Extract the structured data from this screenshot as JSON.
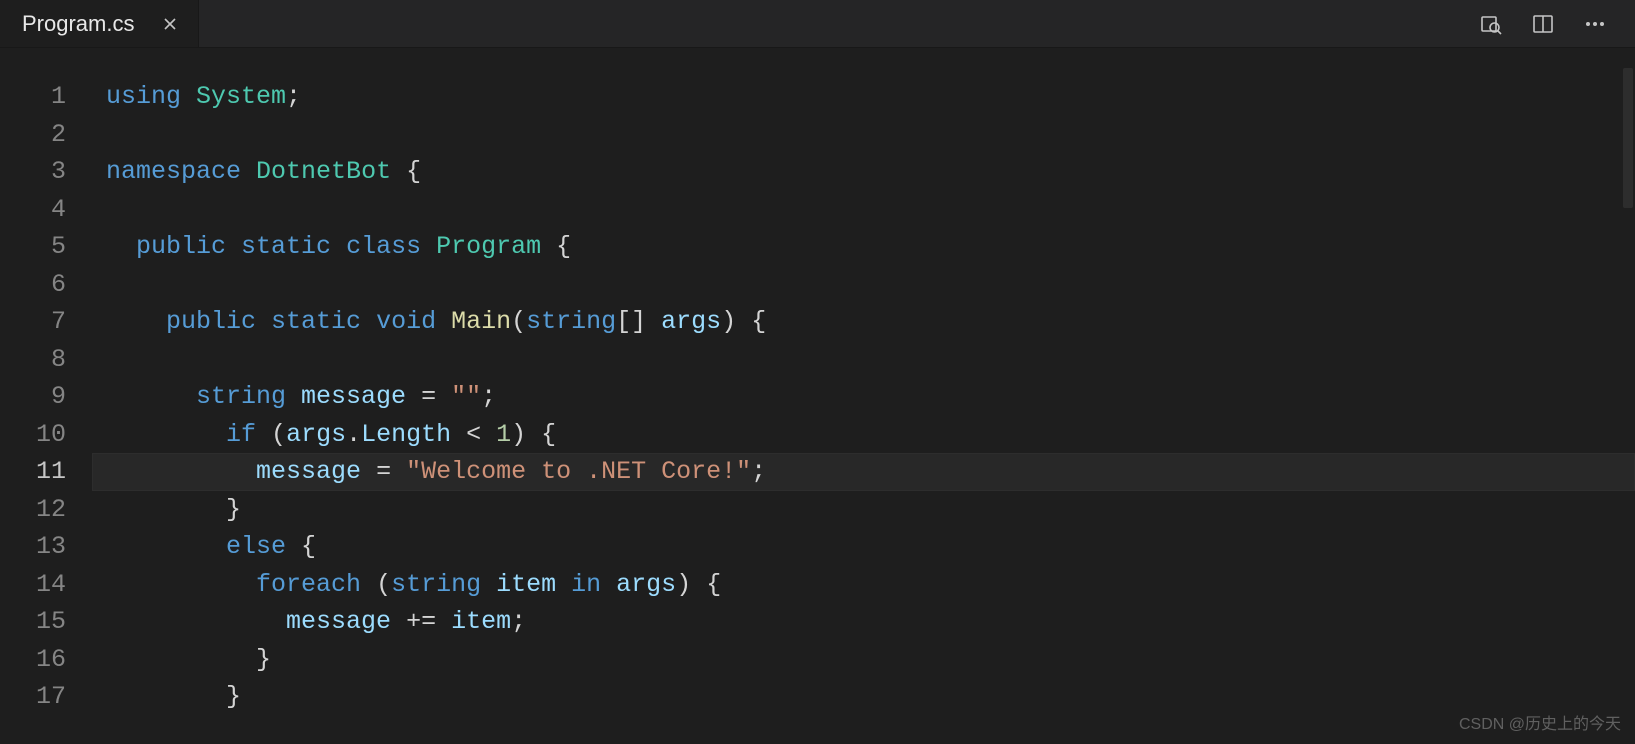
{
  "tab": {
    "filename": "Program.cs"
  },
  "actions": {
    "find": "find-icon",
    "split": "split-editor-icon",
    "more": "more-icon"
  },
  "watermark": "CSDN @历史上的今天",
  "code": {
    "active_line": 11,
    "lines": [
      {
        "n": 1,
        "tokens": [
          [
            "kw",
            "using"
          ],
          [
            "punc",
            " "
          ],
          [
            "type",
            "System"
          ],
          [
            "punc",
            ";"
          ]
        ]
      },
      {
        "n": 2,
        "tokens": []
      },
      {
        "n": 3,
        "tokens": [
          [
            "kw",
            "namespace"
          ],
          [
            "punc",
            " "
          ],
          [
            "type",
            "DotnetBot"
          ],
          [
            "punc",
            " {"
          ]
        ]
      },
      {
        "n": 4,
        "tokens": []
      },
      {
        "n": 5,
        "tokens": [
          [
            "punc",
            "  "
          ],
          [
            "kw",
            "public"
          ],
          [
            "punc",
            " "
          ],
          [
            "kw",
            "static"
          ],
          [
            "punc",
            " "
          ],
          [
            "kw",
            "class"
          ],
          [
            "punc",
            " "
          ],
          [
            "type",
            "Program"
          ],
          [
            "punc",
            " {"
          ]
        ]
      },
      {
        "n": 6,
        "tokens": []
      },
      {
        "n": 7,
        "tokens": [
          [
            "punc",
            "    "
          ],
          [
            "kw",
            "public"
          ],
          [
            "punc",
            " "
          ],
          [
            "kw",
            "static"
          ],
          [
            "punc",
            " "
          ],
          [
            "kw",
            "void"
          ],
          [
            "punc",
            " "
          ],
          [
            "fn",
            "Main"
          ],
          [
            "punc",
            "("
          ],
          [
            "typekw",
            "string"
          ],
          [
            "punc",
            "[] "
          ],
          [
            "var",
            "args"
          ],
          [
            "punc",
            ") {"
          ]
        ]
      },
      {
        "n": 8,
        "tokens": []
      },
      {
        "n": 9,
        "tokens": [
          [
            "punc",
            "      "
          ],
          [
            "typekw",
            "string"
          ],
          [
            "punc",
            " "
          ],
          [
            "var",
            "message"
          ],
          [
            "punc",
            " = "
          ],
          [
            "str",
            "\"\""
          ],
          [
            "punc",
            ";"
          ]
        ]
      },
      {
        "n": 10,
        "tokens": [
          [
            "punc",
            "        "
          ],
          [
            "kw",
            "if"
          ],
          [
            "punc",
            " ("
          ],
          [
            "var",
            "args"
          ],
          [
            "punc",
            "."
          ],
          [
            "var",
            "Length"
          ],
          [
            "punc",
            " < "
          ],
          [
            "num",
            "1"
          ],
          [
            "punc",
            ") {"
          ]
        ]
      },
      {
        "n": 11,
        "tokens": [
          [
            "punc",
            "          "
          ],
          [
            "var",
            "message"
          ],
          [
            "punc",
            " = "
          ],
          [
            "str",
            "\"Welcome to .NET Core!\""
          ],
          [
            "punc",
            ";"
          ]
        ]
      },
      {
        "n": 12,
        "tokens": [
          [
            "punc",
            "        }"
          ]
        ]
      },
      {
        "n": 13,
        "tokens": [
          [
            "punc",
            "        "
          ],
          [
            "kw",
            "else"
          ],
          [
            "punc",
            " {"
          ]
        ]
      },
      {
        "n": 14,
        "tokens": [
          [
            "punc",
            "          "
          ],
          [
            "kw",
            "foreach"
          ],
          [
            "punc",
            " ("
          ],
          [
            "typekw",
            "string"
          ],
          [
            "punc",
            " "
          ],
          [
            "var",
            "item"
          ],
          [
            "punc",
            " "
          ],
          [
            "kw",
            "in"
          ],
          [
            "punc",
            " "
          ],
          [
            "var",
            "args"
          ],
          [
            "punc",
            ") {"
          ]
        ]
      },
      {
        "n": 15,
        "tokens": [
          [
            "punc",
            "            "
          ],
          [
            "var",
            "message"
          ],
          [
            "punc",
            " += "
          ],
          [
            "var",
            "item"
          ],
          [
            "punc",
            ";"
          ]
        ]
      },
      {
        "n": 16,
        "tokens": [
          [
            "punc",
            "          }"
          ]
        ]
      },
      {
        "n": 17,
        "tokens": [
          [
            "punc",
            "        }"
          ]
        ]
      }
    ]
  }
}
